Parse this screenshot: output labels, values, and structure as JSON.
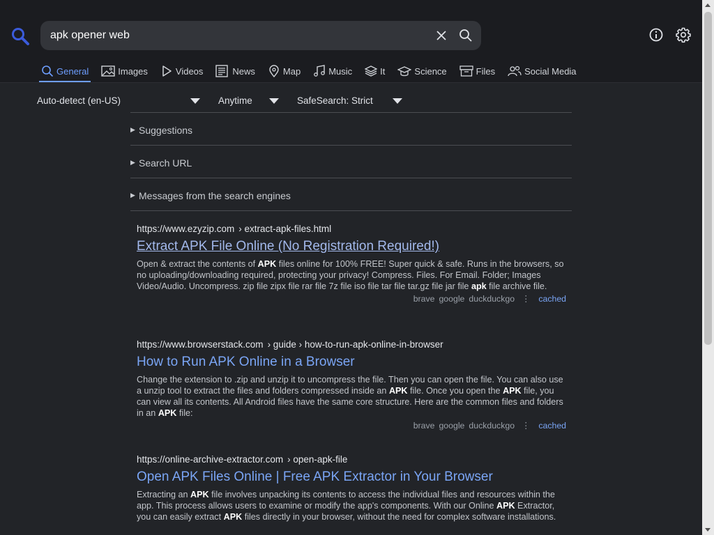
{
  "search": {
    "query": "apk opener web"
  },
  "tabs": [
    {
      "label": "General",
      "icon": "search-icon",
      "active": true
    },
    {
      "label": "Images",
      "icon": "image-icon"
    },
    {
      "label": "Videos",
      "icon": "play-icon"
    },
    {
      "label": "News",
      "icon": "newspaper-icon"
    },
    {
      "label": "Map",
      "icon": "map-pin-icon"
    },
    {
      "label": "Music",
      "icon": "music-icon"
    },
    {
      "label": "It",
      "icon": "layers-icon"
    },
    {
      "label": "Science",
      "icon": "graduation-cap-icon"
    },
    {
      "label": "Files",
      "icon": "archive-icon"
    },
    {
      "label": "Social Media",
      "icon": "users-icon"
    }
  ],
  "filters": {
    "language": "Auto-detect (en-US)",
    "time": "Anytime",
    "safesearch": "SafeSearch: Strict"
  },
  "details": [
    {
      "label": "Suggestions"
    },
    {
      "label": "Search URL"
    },
    {
      "label": "Messages from the search engines"
    }
  ],
  "results": [
    {
      "domain": "https://www.ezyzip.com",
      "path": "› extract-apk-files.html",
      "title": "Extract APK File Online (No Registration Required!)",
      "snippet": "Open & extract the contents of <b>APK</b> files online for 100% FREE! Super quick & safe. Runs in the browsers, so no uploading/downloading required, protecting your privacy! Compress. Files. For Email. Folder; Images Video/Audio. Uncompress. zip file zipx file rar file 7z file iso file tar file tar.gz file jar file <b>apk</b> file archive file.",
      "engines": [
        "brave",
        "google",
        "duckduckgo"
      ],
      "cached": "cached"
    },
    {
      "domain": "https://www.browserstack.com",
      "path": "› guide › how-to-run-apk-online-in-browser",
      "title": "How to Run APK Online in a Browser",
      "snippet": "Change the extension to .zip and unzip it to uncompress the file. Then you can open the file. You can also use a unzip tool to extract the files and folders compressed inside an <b>APK</b> file. Once you open the <b>APK</b> file, you can view all its contents. All Android files have the same core structure. Here are the common files and folders in an <b>APK</b> file:",
      "engines": [
        "brave",
        "google",
        "duckduckgo"
      ],
      "cached": "cached"
    },
    {
      "domain": "https://online-archive-extractor.com",
      "path": "› open-apk-file",
      "title": "Open APK Files Online | Free APK Extractor in Your Browser",
      "snippet": "Extracting an <b>APK</b> file involves unpacking its contents to access the individual files and resources within the app. This process allows users to examine or modify the app's components. With our Online <b>APK</b> Extractor, you can easily extract <b>APK</b> files directly in your browser, without the need for complex software installations.",
      "engines": [],
      "cached": ""
    }
  ],
  "colors": {
    "accent": "#6e9eff",
    "link": "#7aa5f5",
    "logo": "#3b5bdb"
  }
}
